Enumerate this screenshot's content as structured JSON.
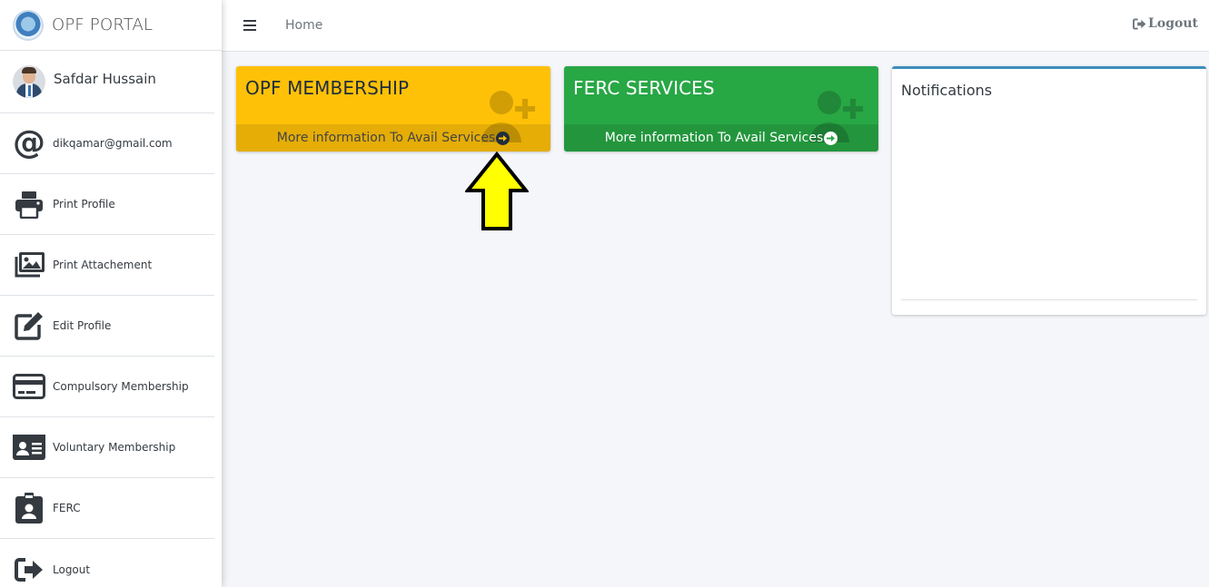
{
  "app": {
    "title": "OPF PORTAL"
  },
  "user": {
    "name": "Safdar Hussain"
  },
  "sidebar": {
    "items": [
      {
        "label": "dikqamar@gmail.com",
        "icon": "at-icon"
      },
      {
        "label": "Print Profile",
        "icon": "print-icon"
      },
      {
        "label": "Print Attachement",
        "icon": "images-icon"
      },
      {
        "label": "Edit Profile",
        "icon": "edit-icon"
      },
      {
        "label": "Compulsory Membership",
        "icon": "credit-card-icon"
      },
      {
        "label": "Voluntary Membership",
        "icon": "id-card-icon"
      },
      {
        "label": "FERC",
        "icon": "id-badge-icon"
      },
      {
        "label": "Logout",
        "icon": "sign-out-icon"
      }
    ]
  },
  "topbar": {
    "home": "Home",
    "logout": "Logout"
  },
  "boxes": [
    {
      "title": "OPF MEMBERSHIP",
      "footer": "More information To Avail Services",
      "color": "#ffc107"
    },
    {
      "title": "FERC SERVICES",
      "footer": "More information To Avail Services",
      "color": "#28a745"
    }
  ],
  "notifications": {
    "title": "Notifications"
  },
  "annotation": {
    "color": "#ffff00",
    "icon": "up-arrow-icon"
  }
}
